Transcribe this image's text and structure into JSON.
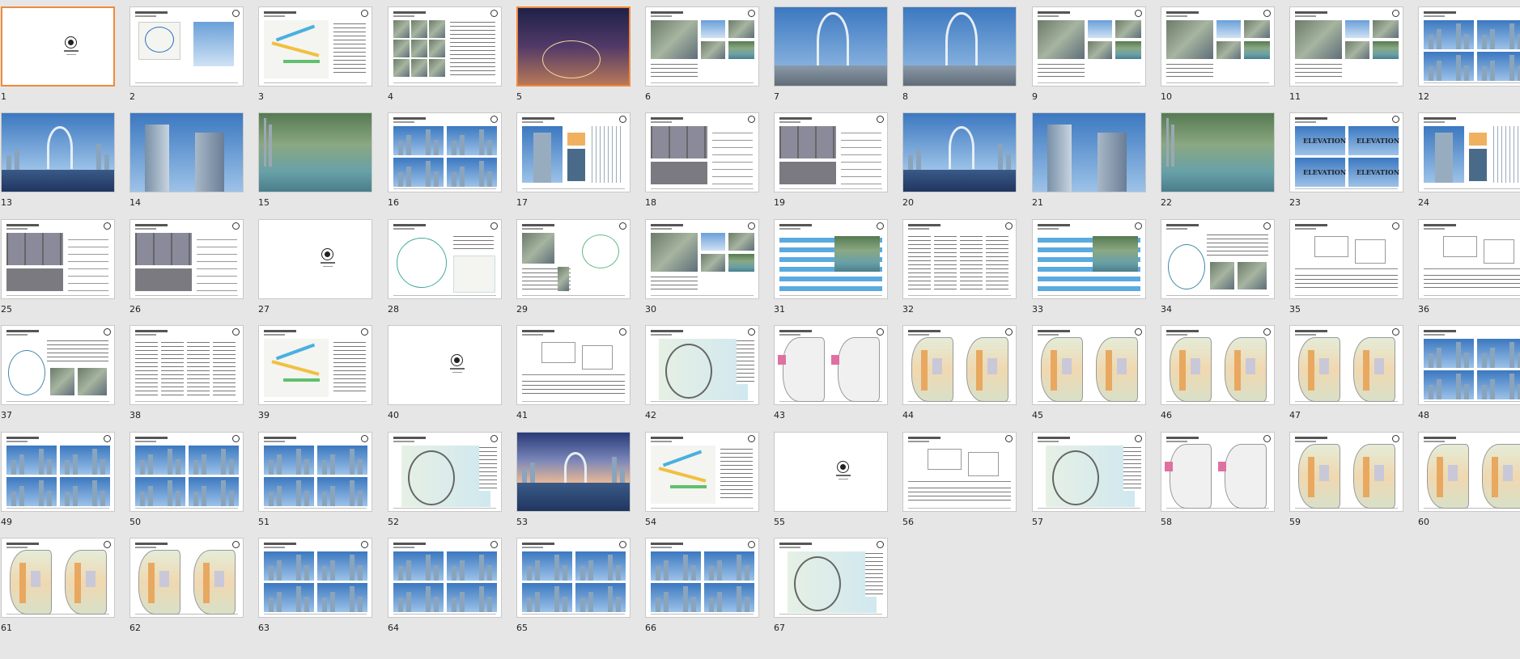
{
  "slides": [
    {
      "number": "1",
      "type": "section-cover",
      "selected": true
    },
    {
      "number": "2",
      "type": "concept-sketch"
    },
    {
      "number": "3",
      "type": "diagram-color"
    },
    {
      "number": "4",
      "type": "photo-grid-text"
    },
    {
      "number": "5",
      "type": "night-aerial",
      "selected": true
    },
    {
      "number": "6",
      "type": "photo-grid"
    },
    {
      "number": "7",
      "type": "gate-render"
    },
    {
      "number": "8",
      "type": "gate-render"
    },
    {
      "number": "9",
      "type": "photo-grid"
    },
    {
      "number": "10",
      "type": "photo-grid"
    },
    {
      "number": "11",
      "type": "photo-grid"
    },
    {
      "number": "12",
      "type": "tower-grid"
    },
    {
      "number": "13",
      "type": "skyline-water"
    },
    {
      "number": "14",
      "type": "towers-close"
    },
    {
      "number": "15",
      "type": "aerial"
    },
    {
      "number": "16",
      "type": "tower-grid"
    },
    {
      "number": "17",
      "type": "tower-detail"
    },
    {
      "number": "18",
      "type": "facade-detail"
    },
    {
      "number": "19",
      "type": "facade-detail"
    },
    {
      "number": "20",
      "type": "skyline-water"
    },
    {
      "number": "21",
      "type": "towers-close"
    },
    {
      "number": "22",
      "type": "aerial"
    },
    {
      "number": "23",
      "type": "elevation-grid"
    },
    {
      "number": "24",
      "type": "tower-detail"
    },
    {
      "number": "25",
      "type": "facade-detail"
    },
    {
      "number": "26",
      "type": "facade-detail"
    },
    {
      "number": "27",
      "type": "section-cover"
    },
    {
      "number": "28",
      "type": "plan-sketch"
    },
    {
      "number": "29",
      "type": "photo-plan"
    },
    {
      "number": "30",
      "type": "photo-grid"
    },
    {
      "number": "31",
      "type": "stripes-diagram"
    },
    {
      "number": "32",
      "type": "text-columns"
    },
    {
      "number": "33",
      "type": "stripes-diagram"
    },
    {
      "number": "34",
      "type": "plan-text"
    },
    {
      "number": "35",
      "type": "diagram-lines"
    },
    {
      "number": "36",
      "type": "diagram-lines"
    },
    {
      "number": "37",
      "type": "plan-text"
    },
    {
      "number": "38",
      "type": "text-columns"
    },
    {
      "number": "39",
      "type": "diagram-color"
    },
    {
      "number": "40",
      "type": "section-cover"
    },
    {
      "number": "41",
      "type": "diagram-lines"
    },
    {
      "number": "42",
      "type": "site-plan"
    },
    {
      "number": "43",
      "type": "floor-plan"
    },
    {
      "number": "44",
      "type": "floor-plan-color"
    },
    {
      "number": "45",
      "type": "floor-plan-color"
    },
    {
      "number": "46",
      "type": "floor-plan-color"
    },
    {
      "number": "47",
      "type": "floor-plan-color"
    },
    {
      "number": "48",
      "type": "tower-grid"
    },
    {
      "number": "49",
      "type": "tower-grid"
    },
    {
      "number": "50",
      "type": "tower-grid"
    },
    {
      "number": "51",
      "type": "tower-grid"
    },
    {
      "number": "52",
      "type": "site-plan"
    },
    {
      "number": "53",
      "type": "dusk-skyline"
    },
    {
      "number": "54",
      "type": "diagram-color"
    },
    {
      "number": "55",
      "type": "section-cover"
    },
    {
      "number": "56",
      "type": "diagram-lines"
    },
    {
      "number": "57",
      "type": "site-plan"
    },
    {
      "number": "58",
      "type": "floor-plan"
    },
    {
      "number": "59",
      "type": "floor-plan-color"
    },
    {
      "number": "60",
      "type": "floor-plan-color"
    },
    {
      "number": "61",
      "type": "floor-plan-color"
    },
    {
      "number": "62",
      "type": "floor-plan-color"
    },
    {
      "number": "63",
      "type": "tower-grid"
    },
    {
      "number": "64",
      "type": "tower-grid"
    },
    {
      "number": "65",
      "type": "tower-grid"
    },
    {
      "number": "66",
      "type": "tower-grid"
    },
    {
      "number": "67",
      "type": "site-plan"
    }
  ],
  "elevation_label": "ELEVATION",
  "colors": {
    "background": "#e6e6e6",
    "selection": "#f08a3c",
    "slide_border": "#c8c8c8"
  }
}
